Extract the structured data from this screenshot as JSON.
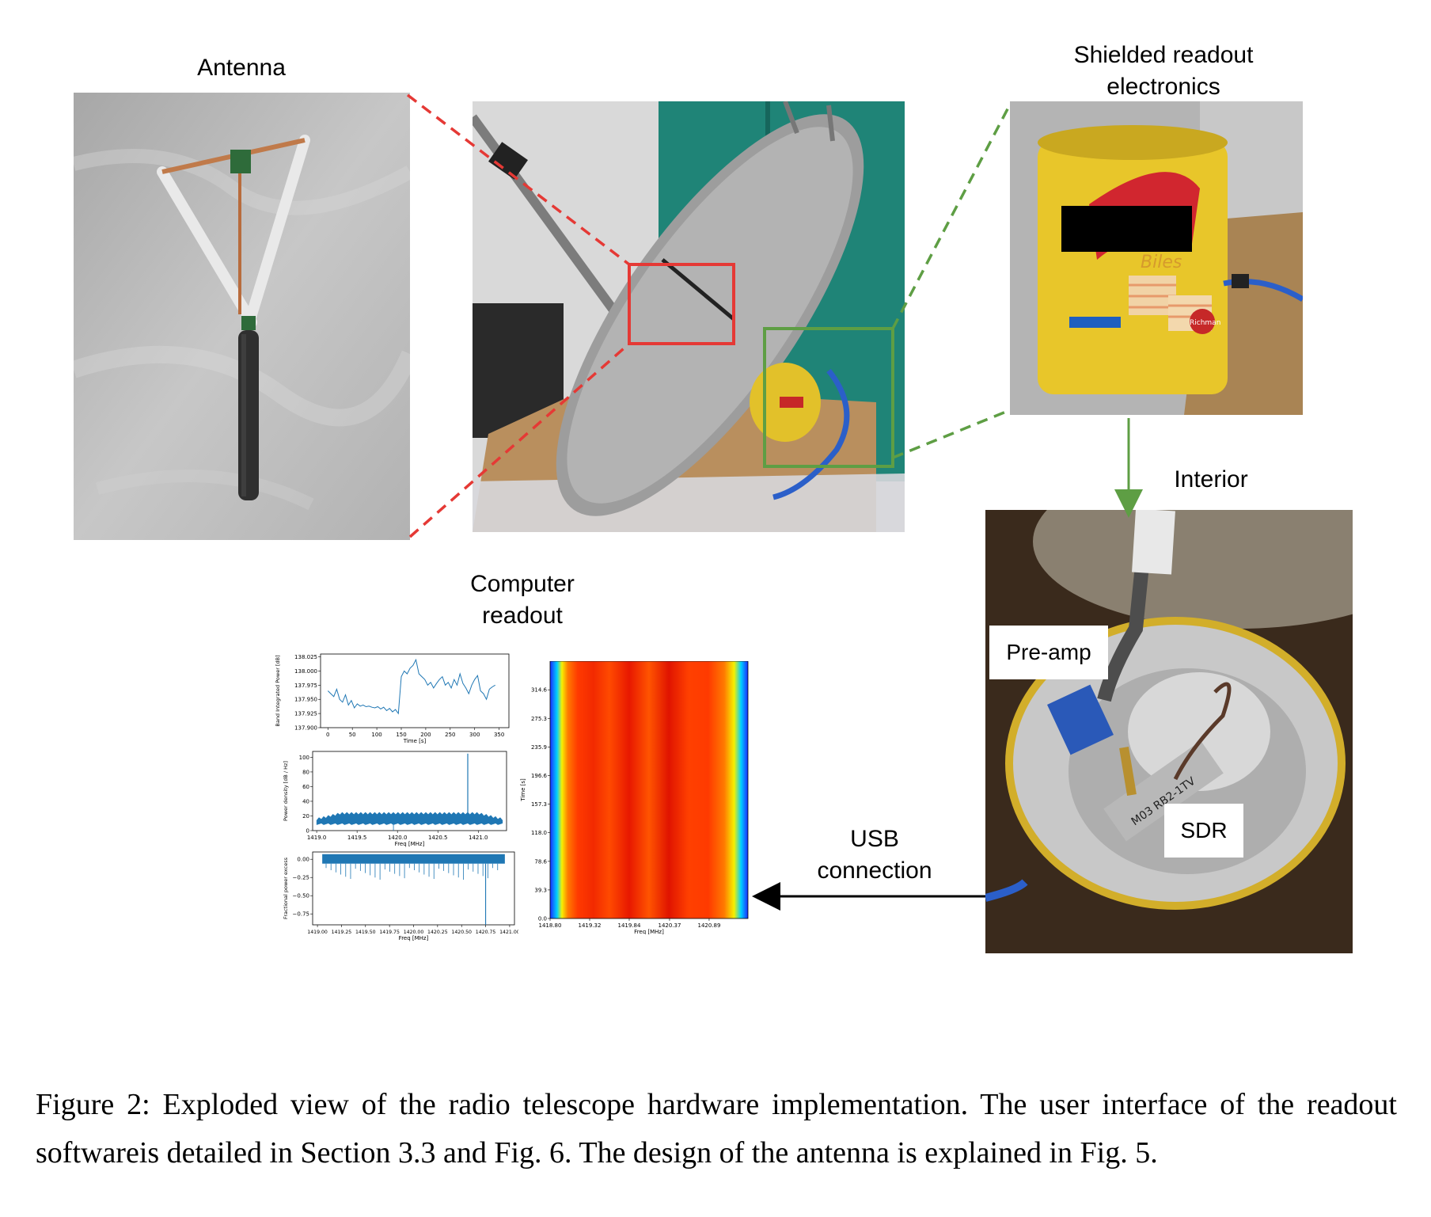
{
  "labels": {
    "antenna": "Antenna",
    "shielded_line1": "Shielded readout",
    "shielded_line2": "electronics",
    "interior": "Interior",
    "computer_line1": "Computer",
    "computer_line2": "readout",
    "usb_line1": "USB",
    "usb_line2": "connection",
    "preamp": "Pre-amp",
    "sdr": "SDR"
  },
  "photo_text": {
    "can_brand": "Biles",
    "can_logo": "Richman",
    "sdr_text": "M03 RB2-1TV"
  },
  "colors": {
    "red_dashed": "#e53935",
    "green_dashed": "#5e9e44",
    "series_blue": "#1f77b4"
  },
  "caption": "Figure 2: Exploded view of the radio telescope hardware implementation. The user interface of the readout softwareis detailed in Section 3.3 and Fig. 6. The design of the antenna is explained in Fig. 5.",
  "chart_data": [
    {
      "type": "line",
      "ylabel": "Band Integrated Power [dB]",
      "xlabel": "Time [s]",
      "xticks": [
        "0",
        "50",
        "100",
        "150",
        "200",
        "250",
        "300",
        "350"
      ],
      "yticks": [
        "137.900",
        "137.925",
        "137.950",
        "137.975",
        "138.000",
        "138.025"
      ],
      "xlim": [
        -15,
        370
      ],
      "ylim": [
        137.9,
        138.03
      ],
      "x": [
        0,
        6,
        12,
        18,
        24,
        30,
        36,
        42,
        48,
        54,
        60,
        66,
        72,
        78,
        84,
        90,
        96,
        102,
        108,
        114,
        120,
        126,
        132,
        138,
        144,
        150,
        156,
        162,
        168,
        174,
        180,
        186,
        192,
        198,
        204,
        210,
        216,
        222,
        228,
        234,
        240,
        246,
        252,
        258,
        264,
        270,
        276,
        282,
        288,
        294,
        300,
        306,
        312,
        318,
        324,
        330,
        336,
        342
      ],
      "values": [
        137.965,
        137.96,
        137.955,
        137.968,
        137.95,
        137.945,
        137.958,
        137.94,
        137.948,
        137.935,
        137.942,
        137.938,
        137.94,
        137.937,
        137.938,
        137.936,
        137.935,
        137.937,
        137.933,
        137.936,
        137.93,
        137.934,
        137.928,
        137.932,
        137.925,
        137.99,
        138.0,
        137.995,
        138.005,
        138.01,
        138.02,
        137.995,
        137.99,
        137.985,
        137.975,
        137.98,
        137.97,
        137.978,
        137.985,
        137.99,
        137.975,
        137.98,
        137.97,
        137.985,
        137.975,
        137.995,
        137.978,
        137.97,
        137.96,
        137.975,
        137.985,
        137.992,
        137.965,
        137.96,
        137.95,
        137.968,
        137.972,
        137.975
      ]
    },
    {
      "type": "area",
      "ylabel": "Power density [dB / Hz]",
      "xlabel": "Freq [MHz]",
      "xticks": [
        "1419.0",
        "1419.5",
        "1420.0",
        "1420.5",
        "1421.0"
      ],
      "yticks": [
        "0",
        "20",
        "40",
        "60",
        "80",
        "100"
      ],
      "xlim": [
        1418.95,
        1421.35
      ],
      "ylim": [
        0,
        108
      ],
      "band": {
        "x_start": 1419.0,
        "x_end": 1421.3,
        "baseline": 14,
        "plateau": 22,
        "spike_x": 1420.87,
        "spike_y": 105
      }
    },
    {
      "type": "area",
      "ylabel": "Fractional power excess",
      "xlabel": "Freq [MHz]",
      "xticks": [
        "1419.00",
        "1419.25",
        "1419.50",
        "1419.75",
        "1420.00",
        "1420.25",
        "1420.50",
        "1420.75",
        "1421.00"
      ],
      "yticks": [
        "−0.75",
        "−0.50",
        "−0.25",
        "0.00"
      ],
      "xlim": [
        1418.95,
        1421.05
      ],
      "ylim": [
        -0.9,
        0.1
      ],
      "band": {
        "x_start": 1419.05,
        "x_end": 1420.95,
        "baseline": 0.0,
        "spike_x": 1420.75,
        "spike_y": -0.9
      }
    },
    {
      "type": "heatmap",
      "ylabel": "Time [s]",
      "xlabel": "Freq [MHz]",
      "xticks": [
        "1418.80",
        "1419.32",
        "1419.84",
        "1420.37",
        "1420.89"
      ],
      "yticks": [
        "0.0",
        "39.3",
        "78.6",
        "118.0",
        "157.3",
        "196.6",
        "235.9",
        "275.3",
        "314.6"
      ],
      "xlim": [
        1418.8,
        1421.4
      ],
      "ylim": [
        0.0,
        354.0
      ]
    }
  ]
}
